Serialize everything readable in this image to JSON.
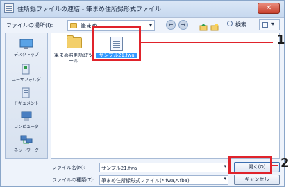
{
  "window": {
    "title": "住所録ファイルの連結 - 筆まめ住所録形式ファイル",
    "close_label": "✕"
  },
  "location": {
    "label": "ファイルの場所(I):",
    "value": "筆まめ"
  },
  "toolbar": {
    "back_symbol": "←",
    "forward_symbol": "→",
    "search_label": "検索",
    "view_symbol": "▾"
  },
  "places": [
    {
      "label": "デスクトップ",
      "icon": "desktop-icon"
    },
    {
      "label": "ユーザフォルダ",
      "icon": "user-folder-icon"
    },
    {
      "label": "ドキュメント",
      "icon": "documents-icon"
    },
    {
      "label": "コンピュータ",
      "icon": "computer-icon"
    },
    {
      "label": "ネットワーク",
      "icon": "network-icon"
    }
  ],
  "files": [
    {
      "label": "筆まめ名刺読取ツール",
      "type": "folder",
      "selected": false
    },
    {
      "label": "サンプル21.fwa",
      "type": "file",
      "selected": true
    }
  ],
  "filename": {
    "label": "ファイル名(N):",
    "value": "サンプル21.fwa"
  },
  "filetype": {
    "label": "ファイルの種類(T):",
    "value": "筆まめ住所録形式ファイル(*.fwa,*.fba)"
  },
  "buttons": {
    "open": "開く(O)",
    "cancel": "キャンセル"
  },
  "annotations": {
    "callout_1": "1",
    "callout_2": "2",
    "color": "#e0232b"
  }
}
